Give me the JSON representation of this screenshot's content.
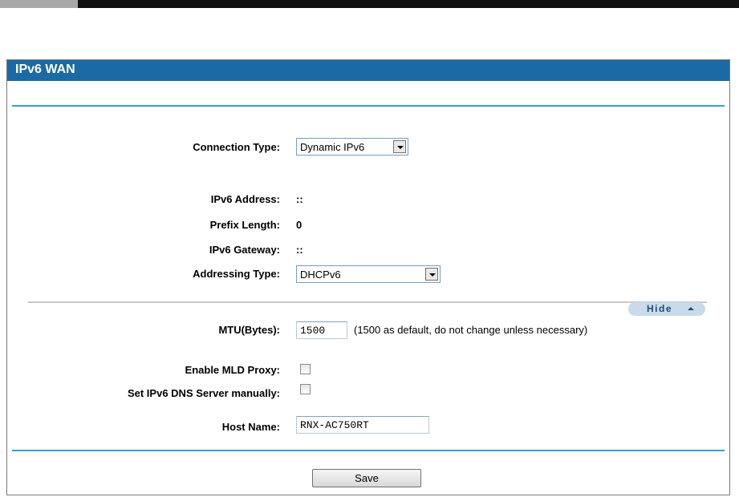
{
  "panel": {
    "title": "IPv6 WAN"
  },
  "connection_type": {
    "label": "Connection Type:",
    "value": "Dynamic IPv6"
  },
  "status": {
    "ipv6_address": {
      "label": "IPv6 Address:",
      "value": "::"
    },
    "prefix_length": {
      "label": "Prefix Length:",
      "value": "0"
    },
    "ipv6_gateway": {
      "label": "IPv6 Gateway:",
      "value": "::"
    }
  },
  "addressing_type": {
    "label": "Addressing Type:",
    "value": "DHCPv6"
  },
  "advanced": {
    "hide_label": "Hide"
  },
  "mtu": {
    "label": "MTU(Bytes):",
    "value": "1500",
    "note": "(1500 as default, do not change unless necessary)"
  },
  "mld_proxy": {
    "label": "Enable MLD Proxy:",
    "checked": false
  },
  "dns_manual": {
    "label": "Set IPv6 DNS Server manually:",
    "checked": false
  },
  "host_name": {
    "label": "Host Name:",
    "value": "RNX-AC750RT"
  },
  "save_label": "Save",
  "colors": {
    "header": "#1a6aa6",
    "rule": "#3a9ed1"
  }
}
